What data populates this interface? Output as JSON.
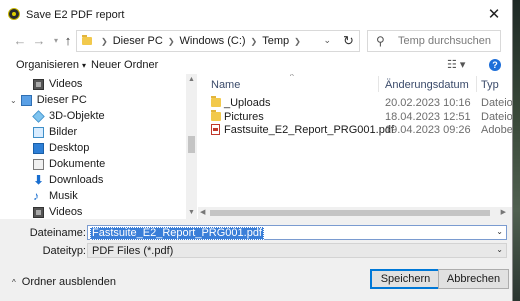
{
  "window": {
    "title": "Save E2 PDF report"
  },
  "nav": {
    "breadcrumbs": [
      "Dieser PC",
      "Windows (C:)",
      "Temp"
    ],
    "search_placeholder": "Temp durchsuchen"
  },
  "toolbar": {
    "organize_label": "Organisieren",
    "new_folder_label": "Neuer Ordner"
  },
  "sidebar": {
    "items": [
      {
        "label": "Videos",
        "icon": "video-icon"
      },
      {
        "label": "Dieser PC",
        "icon": "computer-icon"
      },
      {
        "label": "3D-Objekte",
        "icon": "cube-icon"
      },
      {
        "label": "Bilder",
        "icon": "pictures-icon"
      },
      {
        "label": "Desktop",
        "icon": "desktop-icon"
      },
      {
        "label": "Dokumente",
        "icon": "documents-icon"
      },
      {
        "label": "Downloads",
        "icon": "download-icon"
      },
      {
        "label": "Musik",
        "icon": "music-icon"
      },
      {
        "label": "Videos",
        "icon": "video-icon"
      }
    ]
  },
  "files": {
    "columns": {
      "name": "Name",
      "date": "Änderungsdatum",
      "type": "Typ"
    },
    "rows": [
      {
        "name": "_Uploads",
        "date": "20.02.2023 10:16",
        "type": "Dateiord",
        "icon": "folder-icon"
      },
      {
        "name": "Pictures",
        "date": "18.04.2023 12:51",
        "type": "Dateiord",
        "icon": "folder-icon"
      },
      {
        "name": "Fastsuite_E2_Report_PRG001.pdf",
        "date": "19.04.2023 09:26",
        "type": "Adobe A",
        "icon": "pdf-icon"
      }
    ]
  },
  "form": {
    "filename_label": "Dateiname:",
    "filename_value": "Fastsuite_E2_Report_PRG001.pdf",
    "filetype_label": "Dateityp:",
    "filetype_value": "PDF Files (*.pdf)"
  },
  "footer": {
    "hide_folders_label": "Ordner ausblenden",
    "save_label": "Speichern",
    "cancel_label": "Abbrechen"
  },
  "colors": {
    "accent": "#0078d7",
    "selection": "#3a7ed8",
    "folder": "#f2c94c"
  }
}
